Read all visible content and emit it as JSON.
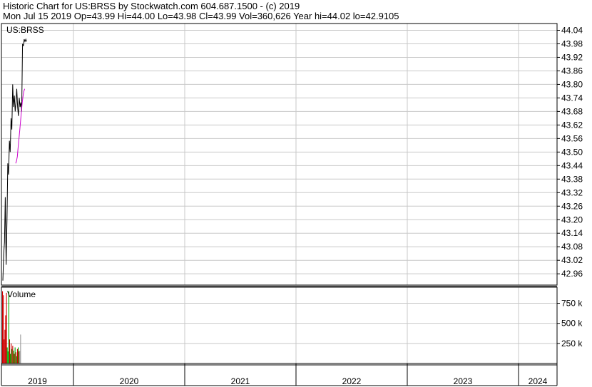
{
  "header": {
    "line1": "Historic Chart for US:BRSS by Stockwatch.com 604.687.1500 - (c) 2019",
    "line2": "Mon Jul 15 2019  Op=43.99  Hi=44.00  Lo=43.98  Cl=43.99  Vol=360,626  Year hi=44.02  lo=42.9105"
  },
  "chart_data": [
    {
      "type": "line",
      "title": "US:BRSS",
      "ylim": [
        42.91,
        44.07
      ],
      "y_ticks": [
        "44.04",
        "43.98",
        "43.92",
        "43.86",
        "43.80",
        "43.74",
        "43.68",
        "43.62",
        "43.56",
        "43.50",
        "43.44",
        "43.38",
        "43.32",
        "43.26",
        "43.20",
        "43.14",
        "43.08",
        "43.02",
        "42.96"
      ],
      "x_ticks": [
        "2019",
        "2020",
        "2021",
        "2022",
        "2023",
        "2024"
      ],
      "grid": true,
      "series": [
        {
          "values_y": [
            42.93,
            43.05,
            43.1,
            43.3,
            43.0,
            43.2,
            43.45,
            43.4,
            43.55,
            43.5,
            43.65,
            43.6,
            43.8,
            43.7,
            43.75,
            43.68,
            43.72,
            43.78,
            43.7,
            43.66,
            43.74,
            43.7,
            43.72,
            43.68,
            43.98,
            43.97,
            44.0,
            43.99,
            44.0,
            43.99
          ],
          "color": "#000000"
        },
        {
          "values_y": [
            43.45,
            43.46,
            43.48,
            43.52,
            43.56,
            43.6,
            43.64,
            43.68,
            43.72,
            43.75,
            43.77,
            43.78
          ],
          "color": "#cc00cc"
        }
      ]
    },
    {
      "type": "bar",
      "title": "Volume",
      "ylim": [
        0,
        950000
      ],
      "y_ticks": [
        "750 k",
        "500 k",
        "250 k"
      ],
      "values": [
        900000,
        850000,
        300000,
        420000,
        600000,
        880000,
        200000,
        150000,
        900000,
        300000,
        120000,
        250000,
        180000,
        220000,
        160000,
        120000,
        200000,
        140000,
        90000,
        180000,
        200000,
        150000,
        160000,
        360626
      ],
      "colors": [
        "#cc0000",
        "#cc0000",
        "#cc0000",
        "#cc0000",
        "#cc0000",
        "#cc0000",
        "#00aa00",
        "#00aa00",
        "#00aa00",
        "#cc0000",
        "#00aa00",
        "#cc0000",
        "#00aa00",
        "#cc0000",
        "#00aa00",
        "#cc0000",
        "#00aa00",
        "#cc0000",
        "#00aa00",
        "#cc0000",
        "#00aa00",
        "#cc0000",
        "#999999",
        "#999999"
      ]
    }
  ]
}
